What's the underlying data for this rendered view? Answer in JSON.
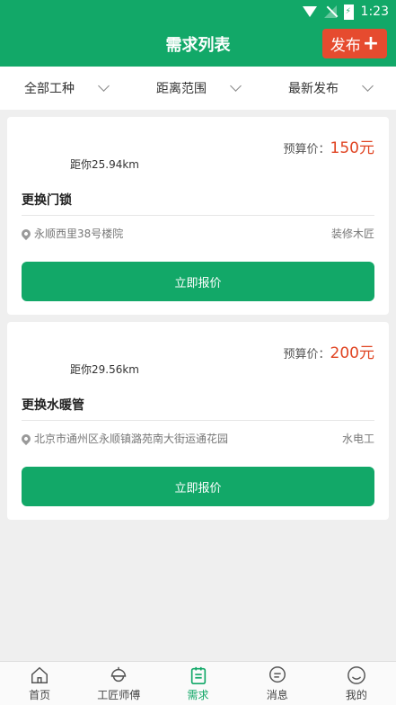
{
  "status": {
    "time": "1:23"
  },
  "header": {
    "title": "需求列表",
    "publish_label": "发布",
    "publish_icon": "+"
  },
  "filters": [
    "全部工种",
    "距离范围",
    "最新发布"
  ],
  "cards": [
    {
      "budget_label": "预算价：",
      "price": "150元",
      "distance": "距你25.94km",
      "title": "更换门锁",
      "address": "永顺西里38号楼院",
      "trade": "装修木匠",
      "button": "立即报价"
    },
    {
      "budget_label": "预算价：",
      "price": "200元",
      "distance": "距你29.56km",
      "title": "更换水暖管",
      "address": "北京市通州区永顺镇潞苑南大街运通花园",
      "trade": "水电工",
      "button": "立即报价"
    }
  ],
  "tabs": [
    {
      "label": "首页",
      "icon": "home-icon"
    },
    {
      "label": "工匠师傅",
      "icon": "worker-icon"
    },
    {
      "label": "需求",
      "icon": "clipboard-icon"
    },
    {
      "label": "消息",
      "icon": "message-icon"
    },
    {
      "label": "我的",
      "icon": "profile-icon"
    }
  ],
  "colors": {
    "primary": "#12a868",
    "accent": "#e64b2f",
    "price": "#e04422"
  }
}
